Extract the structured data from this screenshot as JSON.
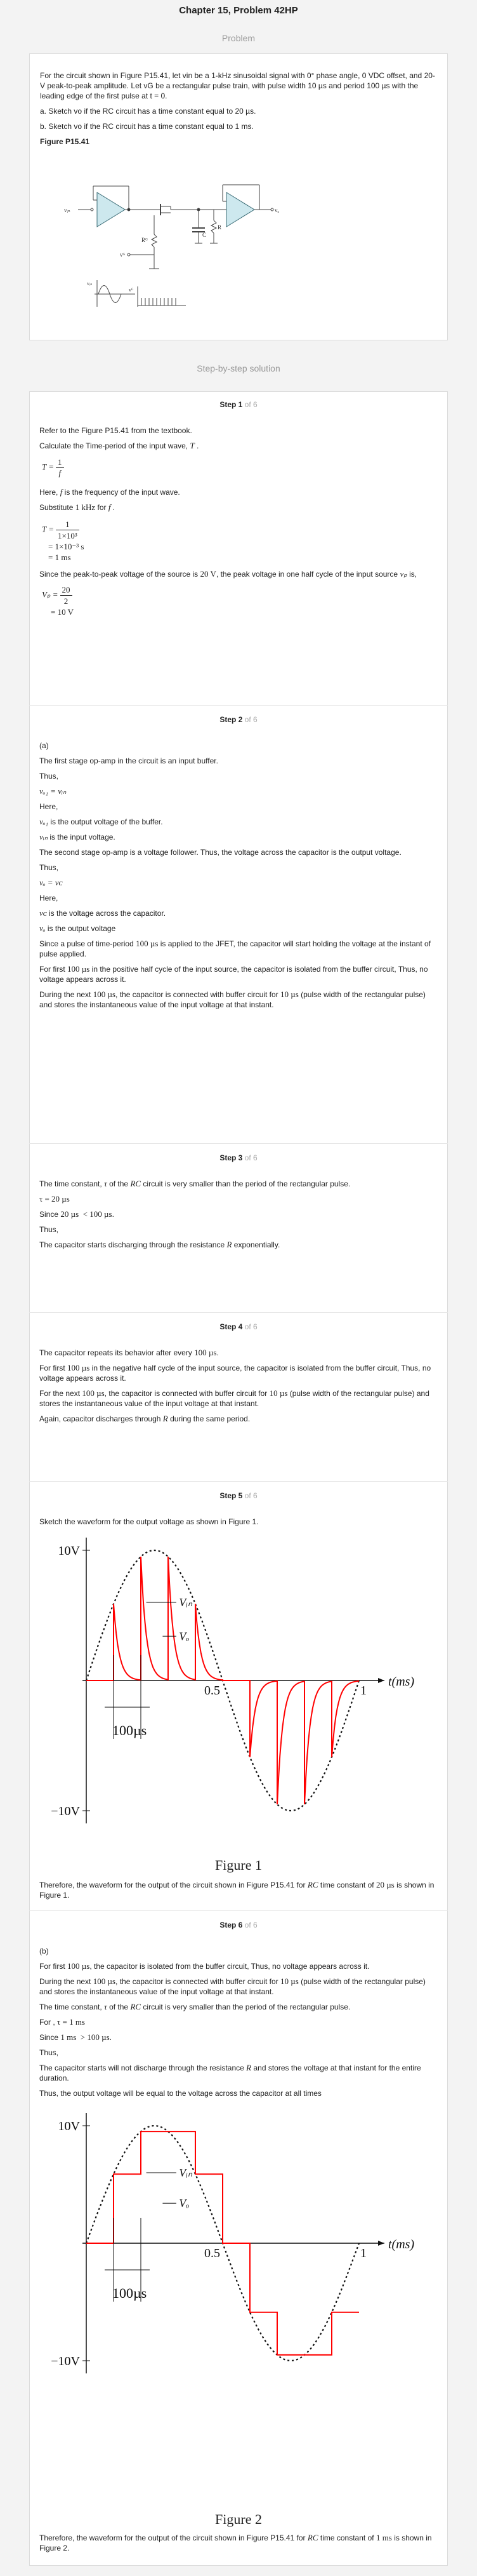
{
  "title": "Chapter 15, Problem 42HP",
  "problem_label": "Problem",
  "solution_label": "Step-by-step solution",
  "problem": {
    "p1": "For the circuit shown in Figure P15.41, let vin be a 1-kHz sinusoidal signal with 0° phase angle, 0 VDC offset, and 20-V peak-to-peak amplitude. Let vG be a rectangular pulse train, with pulse width 10 µs and period 100 µs with the leading edge of the first pulse at t = 0.",
    "a": "a. Sketch vo if the RC circuit has a time constant equal to 20 µs.",
    "b": "b. Sketch vo if the RC circuit has a time constant equal to 1 ms.",
    "fig_label": "Figure P15.41",
    "fig_vin": "vᵢₙ",
    "fig_vo": "vₒ",
    "fig_rg": "Rᴳ",
    "fig_vg": "vᴳ",
    "fig_c": "C",
    "fig_r": "R",
    "fig_wave_label1": "vᵢₙ",
    "fig_wave_label2": "vᴳ"
  },
  "steps": [
    {
      "head": "Step 1",
      "of": "of 6",
      "l1": "Refer to the Figure P15.41 from the textbook.",
      "l2": "Calculate the Time-period of the input wave,",
      "l2v": "T",
      "eq1_lhs": "T =",
      "eq1_num": "1",
      "eq1_den": "f",
      "l3": "Here,",
      "l3v": "f",
      "l3b": "is the frequency of the input wave.",
      "l4": "Substitute",
      "l4v": "1 kHz",
      "l4b": "for",
      "l4c": "f",
      "eq2_lhs": "T =",
      "eq2_num": "1",
      "eq2_den": "1×10³",
      "eq2_l2": "= 1×10⁻³ s",
      "eq2_l3": "= 1 ms",
      "l5": "Since the peak-to-peak voltage of the source is",
      "l5v": "20 V",
      "l5b": ", the peak voltage in one half cycle of the input source",
      "l5c": "vₚ",
      "l5d": "is,",
      "eq3_lhs": "Vₚ =",
      "eq3_num": "20",
      "eq3_den": "2",
      "eq3_l2": "= 10 V"
    },
    {
      "head": "Step 2",
      "of": "of 6",
      "a": "(a)",
      "l1": "The first stage op-amp in the circuit is an input buffer.",
      "l2": "Thus,",
      "eq1": "vₒ₁ = vᵢₙ",
      "l3": "Here,",
      "l4v": "vₒ₁",
      "l4": "is the output voltage of the buffer.",
      "l5v": "vᵢₙ",
      "l5": "is the input voltage.",
      "l6": "The second stage op-amp is a voltage follower. Thus, the voltage across the capacitor is the output voltage.",
      "l7": "Thus,",
      "eq2": "vₒ = vᴄ",
      "l8": "Here,",
      "l9v": "vᴄ",
      "l9": "is the voltage across the capacitor.",
      "l10v": "vₒ",
      "l10": "is the output voltage",
      "l11a": "Since a pulse of time-period",
      "l11v": "100 µs",
      "l11b": "is applied to the JFET, the capacitor will start holding the voltage at the instant of pulse applied.",
      "l12a": "For first",
      "l12v": "100 µs",
      "l12b": "in the positive half cycle of the input source, the capacitor is isolated from the buffer circuit, Thus, no voltage appears across it.",
      "l13a": "During the next",
      "l13v": "100 µs",
      "l13b": ", the capacitor is connected with buffer circuit for",
      "l13v2": "10 µs",
      "l13c": "(pulse width of the rectangular pulse) and stores the instantaneous value of the input voltage at that instant."
    },
    {
      "head": "Step 3",
      "of": "of 6",
      "l1a": "The time constant,",
      "l1v": "τ",
      "l1b": "of the",
      "l1v2": "RC",
      "l1c": "circuit is very smaller than the period of the rectangular pulse.",
      "eq1": "τ = 20 µs",
      "l2a": "Since",
      "l2v": "20 µs < 100 µs",
      "l2b": ".",
      "l3": "Thus,",
      "l4a": "The capacitor starts discharging through the resistance",
      "l4v": "R",
      "l4b": "exponentially."
    },
    {
      "head": "Step 4",
      "of": "of 6",
      "l1a": "The capacitor repeats its behavior after every",
      "l1v": "100 µs",
      "l1b": ".",
      "l2a": "For first",
      "l2v": "100 µs",
      "l2b": "in the negative half cycle of the input source, the capacitor is isolated from the buffer circuit, Thus, no voltage appears across it.",
      "l3a": "For the next",
      "l3v": "100 µs",
      "l3b": ", the capacitor is connected with buffer circuit for",
      "l3v2": "10 µs",
      "l3c": "(pulse width of the rectangular pulse) and stores the instantaneous value of the input voltage at that instant.",
      "l4a": "Again, capacitor discharges through",
      "l4v": "R",
      "l4b": "during the same period."
    },
    {
      "head": "Step 5",
      "of": "of 6",
      "l1": "Sketch the waveform for the output voltage as shown in Figure 1.",
      "caption": "Figure 1",
      "l2a": "Therefore, the waveform for the output of the circuit shown in Figure P15.41 for",
      "l2v": "RC",
      "l2b": "time constant of",
      "l2v2": "20 µs",
      "l2c": "is shown in Figure 1."
    },
    {
      "head": "Step 6",
      "of": "of 6",
      "b": "(b)",
      "l1a": "For first",
      "l1v": "100 µs",
      "l1b": ", the capacitor is isolated from the buffer circuit, Thus, no voltage appears across it.",
      "l2a": "During the next",
      "l2v": "100 µs",
      "l2b": ", the capacitor is connected with buffer circuit for",
      "l2v2": "10 µs",
      "l2c": "(pulse width of the rectangular pulse) and stores the instantaneous value of the input voltage at that instant.",
      "l3a": "The time constant,",
      "l3v": "τ",
      "l3b": "of the",
      "l3v2": "RC",
      "l3c": "circuit is very smaller than the period of the rectangular pulse.",
      "l4a": "For ,",
      "l4v": "τ = 1 ms",
      "l5a": "Since",
      "l5v": "1 ms > 100 µs",
      "l5b": ".",
      "l6": "Thus,",
      "l7a": "The capacitor starts will not discharge through the resistance",
      "l7v": "R",
      "l7b": "and stores the voltage at that instant for the entire duration.",
      "l8": "Thus, the output voltage will be equal to the voltage across the capacitor at all times",
      "caption": "Figure 2",
      "l9a": "Therefore, the waveform for the output of the circuit shown in Figure P15.41 for",
      "l9v": "RC",
      "l9b": "time constant of",
      "l9v2": "1 ms",
      "l9c": "is shown in Figure 2."
    }
  ],
  "graph": {
    "ymax": "10V",
    "ymin": "−10V",
    "xmid": "0.5",
    "xend": "1",
    "xaxis": "t(ms)",
    "vin": "Vᵢₙ",
    "vo": "Vₒ",
    "dt": "100µs"
  },
  "colors": {
    "wave": "#ff0000",
    "accent": "#aaaaaa"
  }
}
